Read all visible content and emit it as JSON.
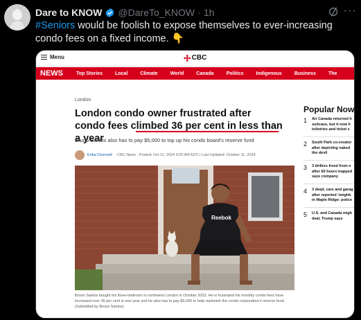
{
  "tweet": {
    "author_name": "Dare to KNOW",
    "handle": "@DareTo_KNOW",
    "separator": "·",
    "time": "1h",
    "more_label": "···",
    "text_hashtag": "#Seniors",
    "text_body": " would be foolish to expose themselves to ever-increasing condo fees on a fixed income. ",
    "text_emoji": "👇"
  },
  "colors": {
    "brand": "#d6001c",
    "link": "#1d9bf0",
    "verified": "#1d9bf0"
  },
  "cbc": {
    "menu_label": "Menu",
    "logo_text": "CBC",
    "nav_news": "NEWS",
    "nav_items": [
      "Top Stories",
      "Local",
      "Climate",
      "World",
      "Canada",
      "Politics",
      "Indigenous",
      "Business",
      "The"
    ]
  },
  "article": {
    "section": "London",
    "headline": "London condo owner frustrated after condo fees climbed 36 per cent in less than a year",
    "dek": "Bruno Santos also has to pay $5,000 to top up his condo board's reserve fund",
    "author": "Erika Chorostil",
    "byline_rest": " · CBC News · Posted: Oct 11, 2024 5:00 AM EDT | Last Updated: October 11, 2024",
    "caption": "Bruno Santos bought his three-bedroom in northwest London in October 2023. He is frustrated his monthly condo fees have increased over 36 per cent in one year and he also has to pay $5,000 to help replenish the condo corporation's reserve fund. (Submitted by Bruno Santos)",
    "shirt_text": "Reebok"
  },
  "popular": {
    "title": "Popular Now in",
    "items": [
      {
        "num": "1",
        "lines": [
          "Air Canada returned h",
          "suitcase, but it now h",
          "toiletries and ticket s"
        ]
      },
      {
        "num": "2",
        "lines": [
          "South Park co-creator",
          "after depicting naked",
          "the devil"
        ]
      },
      {
        "num": "3",
        "lines": [
          "3 drillers freed from n",
          "after 60 hours trapped",
          "says company"
        ]
      },
      {
        "num": "4",
        "lines": [
          "3 dead, cars and garag",
          "after reported 'neighb",
          "in Maple Ridge: police"
        ]
      },
      {
        "num": "5",
        "lines": [
          "U.S. and Canada migh",
          "deal, Trump says"
        ]
      }
    ]
  }
}
